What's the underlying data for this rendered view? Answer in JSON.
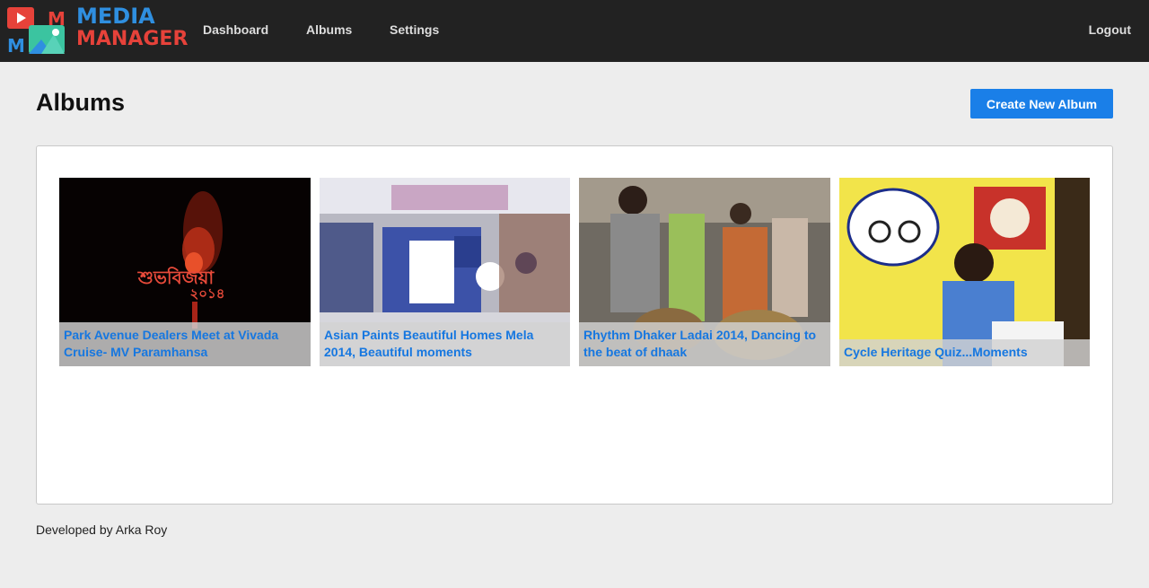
{
  "app": {
    "logo_line1": "MEDIA",
    "logo_line2": "MANAGER",
    "brand_colors": {
      "blue": "#2f8fe0",
      "red": "#e6423a"
    }
  },
  "nav": {
    "items": [
      {
        "label": "Dashboard"
      },
      {
        "label": "Albums"
      },
      {
        "label": "Settings"
      }
    ],
    "logout_label": "Logout"
  },
  "main": {
    "title": "Albums",
    "create_button_label": "Create New Album",
    "accent_color": "#1a7fe8"
  },
  "albums": [
    {
      "title": "Park Avenue Dealers Meet at Vivada Cruise- MV Paramhansa",
      "thumbnail": "night-sign-photo",
      "thumbnail_text_line1": "শুভবিজয়া",
      "thumbnail_text_line2": "২০১৪"
    },
    {
      "title": "Asian Paints Beautiful Homes Mela 2014, Beautiful moments",
      "thumbnail": "exhibition-booth-photo"
    },
    {
      "title": "Rhythm Dhaker Ladai 2014, Dancing to the beat of dhaak",
      "thumbnail": "drummers-crowd-photo"
    },
    {
      "title": "Cycle Heritage Quiz...Moments",
      "thumbnail": "quiz-boy-photo"
    }
  ],
  "footer": {
    "text": "Developed by Arka Roy"
  }
}
